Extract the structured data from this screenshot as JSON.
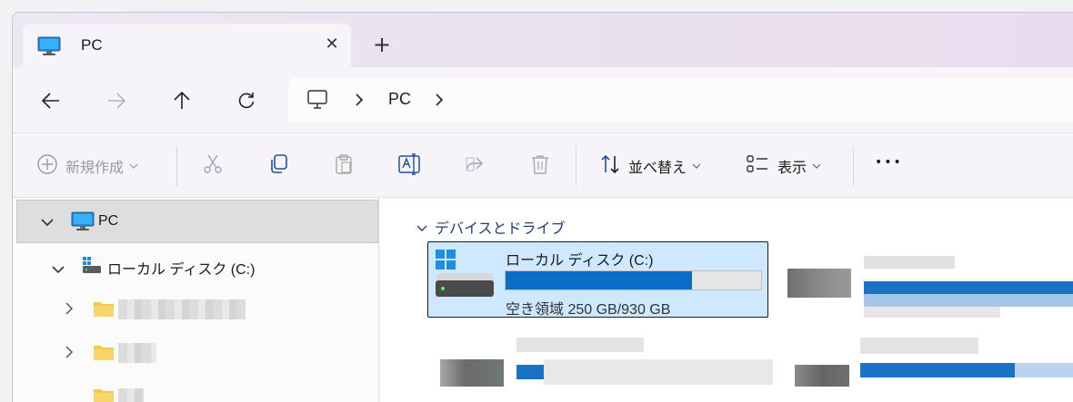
{
  "tab": {
    "title": "PC",
    "close_label": "✕",
    "new_tab_label": "+"
  },
  "address": {
    "crumb": "PC"
  },
  "toolbar": {
    "new_label": "新規作成",
    "sort_label": "並べ替え",
    "view_label": "表示",
    "more_label": "•••"
  },
  "sidebar": {
    "pc_label": "PC",
    "drive_label": "ローカル ディスク (C:)"
  },
  "content": {
    "group_label": "デバイスとドライブ",
    "drive": {
      "name": "ローカル ディスク (C:)",
      "free_text": "空き領域 250 GB/930 GB",
      "used_fraction": 0.731
    }
  },
  "colors": {
    "accent": "#0a6fc4",
    "selection": "#cde8ff",
    "folder": "#f2c94c"
  }
}
